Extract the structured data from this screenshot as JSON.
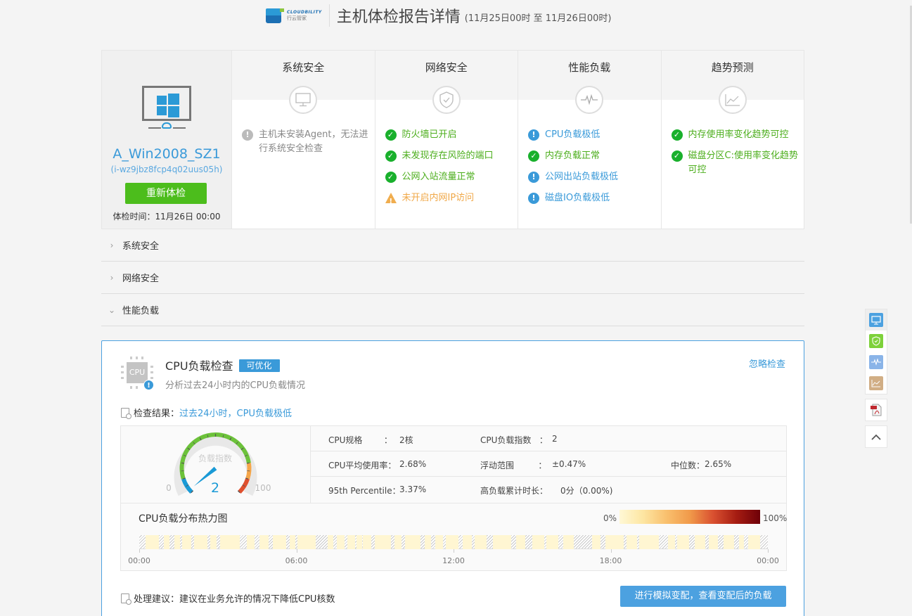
{
  "header": {
    "logo_en": "CLOUDBILITY",
    "logo_cn": "行云管家",
    "title": "主机体检报告详情",
    "subtitle": "(11月25日00时 至 11月26日00时)"
  },
  "host": {
    "name": "A_Win2008_SZ1",
    "id": "(i-wz9jbz8fcp4q02uus05h)",
    "recheck_label": "重新体检",
    "check_time": "体检时间：11月26日 00:00"
  },
  "categories": [
    {
      "title": "系统安全",
      "icon": "monitor-icon",
      "items": [
        {
          "status": "na",
          "text": "主机未安装Agent，无法进行系统安全检查"
        }
      ]
    },
    {
      "title": "网络安全",
      "icon": "shield-icon",
      "items": [
        {
          "status": "ok",
          "text": "防火墙已开启"
        },
        {
          "status": "ok",
          "text": "未发现存在风险的端口"
        },
        {
          "status": "ok",
          "text": "公网入站流量正常"
        },
        {
          "status": "warn",
          "text": "未开启内网IP访问"
        }
      ]
    },
    {
      "title": "性能负载",
      "icon": "pulse-icon",
      "items": [
        {
          "status": "info",
          "text": "CPU负载极低"
        },
        {
          "status": "ok",
          "text": "内存负载正常"
        },
        {
          "status": "info",
          "text": "公网出站负载极低"
        },
        {
          "status": "info",
          "text": "磁盘IO负载极低"
        }
      ]
    },
    {
      "title": "趋势预测",
      "icon": "trend-icon",
      "items": [
        {
          "status": "ok",
          "text": "内存使用率变化趋势可控"
        },
        {
          "status": "ok",
          "text": "磁盘分区C:使用率变化趋势可控"
        }
      ]
    }
  ],
  "accordion": [
    {
      "label": "系统安全",
      "expanded": false
    },
    {
      "label": "网络安全",
      "expanded": false
    },
    {
      "label": "性能负载",
      "expanded": true
    }
  ],
  "detail": {
    "icon_text": "CPU",
    "title": "CPU负载检查",
    "tag": "可优化",
    "subtitle": "分析过去24小时内的CPU负载情况",
    "ignore_label": "忽略检查",
    "result_key": "检查结果：",
    "result_value": "过去24小时，CPU负载极低",
    "gauge": {
      "label": "负载指数",
      "value": 2,
      "min": 0,
      "max": 100,
      "min_label": "0",
      "max_label": "100"
    },
    "stats": {
      "cpu_spec_k": "CPU规格        ：",
      "cpu_spec_v": "2核",
      "load_index_k": "CPU负载指数   ：",
      "load_index_v": "2",
      "avg_k": "CPU平均使用率：",
      "avg_v": "2.68%",
      "range_k": "浮动范围         ：",
      "range_v": "±0.47%",
      "median_k": "中位数：",
      "median_v": "2.65%",
      "p95_k": "95th Percentile：",
      "p95_v": "3.37%",
      "high_k": "高负载累计时长：",
      "high_v": "0分（0.00%)"
    },
    "heatmap": {
      "title": "CPU负载分布热力图",
      "legend_min": "0%",
      "legend_max": "100%",
      "ticks": [
        "00:00",
        "06:00",
        "12:00",
        "18:00",
        "00:00"
      ]
    },
    "advice_key": "处理建议：",
    "advice_value": "建议在业务允许的情况下降低CPU核数",
    "simulate_label": "进行模拟变配，查看变配后的负载"
  },
  "chart_data": {
    "type": "heatmap",
    "title": "CPU负载分布热力图",
    "x_range_hours": [
      0,
      24
    ],
    "xticks": [
      "00:00",
      "06:00",
      "12:00",
      "18:00",
      "00:00"
    ],
    "color_scale": {
      "min": "0%",
      "max": "100%",
      "colors": [
        "#fff8d6",
        "#f9c06e",
        "#d95030",
        "#6e0008"
      ]
    },
    "low_load_segments_hours": [
      [
        0.25,
        0.75
      ],
      [
        0.95,
        1.15
      ],
      [
        1.35,
        1.55
      ],
      [
        1.65,
        2.0
      ],
      [
        2.1,
        2.6
      ],
      [
        2.7,
        2.95
      ],
      [
        3.1,
        3.85
      ],
      [
        4.1,
        4.4
      ],
      [
        4.6,
        4.95
      ],
      [
        5.1,
        5.6
      ],
      [
        5.75,
        5.95
      ],
      [
        6.05,
        6.75
      ],
      [
        7.2,
        7.4
      ],
      [
        7.55,
        7.85
      ],
      [
        7.95,
        8.25
      ],
      [
        8.3,
        8.5
      ],
      [
        8.55,
        8.85
      ],
      [
        9.0,
        9.6
      ],
      [
        9.75,
        10.0
      ],
      [
        10.15,
        10.75
      ],
      [
        10.9,
        11.15
      ],
      [
        11.3,
        11.6
      ],
      [
        11.7,
        12.2
      ],
      [
        12.35,
        12.7
      ],
      [
        12.8,
        13.25
      ],
      [
        13.5,
        14.2
      ],
      [
        14.4,
        14.75
      ],
      [
        15.0,
        15.45
      ],
      [
        15.55,
        16.0
      ],
      [
        16.2,
        16.6
      ],
      [
        17.3,
        17.6
      ],
      [
        17.8,
        18.5
      ],
      [
        18.6,
        19.0
      ],
      [
        19.1,
        19.85
      ],
      [
        20.2,
        20.45
      ],
      [
        20.55,
        21.0
      ],
      [
        21.2,
        21.6
      ],
      [
        21.75,
        22.1
      ],
      [
        22.3,
        22.7
      ],
      [
        22.9,
        23.1
      ],
      [
        23.25,
        23.7
      ]
    ],
    "other_time": "no data (hatched)",
    "gauge_value": 2
  }
}
